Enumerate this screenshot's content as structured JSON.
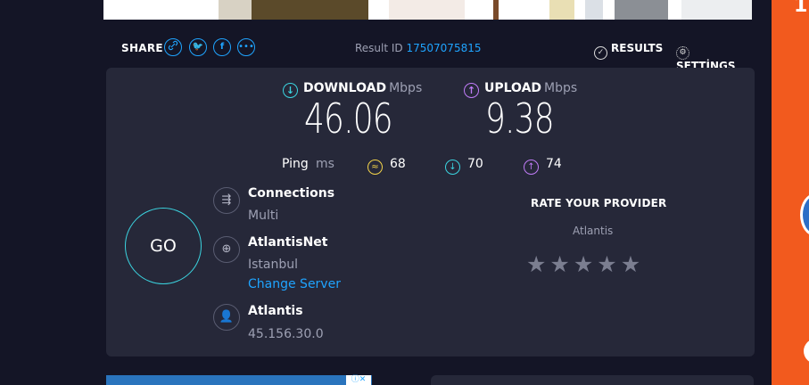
{
  "share": {
    "label": "SHARE",
    "icons": [
      "link-icon",
      "twitter-icon",
      "facebook-icon",
      "more-icon"
    ]
  },
  "result": {
    "label": "Result ID",
    "id": "17507075815"
  },
  "nav": {
    "results": "RESULTS",
    "settings": "SETTİNGS"
  },
  "download": {
    "label": "DOWNLOAD",
    "unit": "Mbps",
    "value": "46.06"
  },
  "upload": {
    "label": "UPLOAD",
    "unit": "Mbps",
    "value": "9.38"
  },
  "ping": {
    "label": "Ping",
    "unit": "ms",
    "idle": "68",
    "down": "70",
    "up": "74"
  },
  "go": {
    "label": "GO"
  },
  "connections": {
    "title": "Connections",
    "value": "Multi"
  },
  "server": {
    "title": "AtlantisNet",
    "location": "Istanbul",
    "change": "Change Server"
  },
  "client": {
    "title": "Atlantis",
    "ip": "45.156.30.0"
  },
  "rating": {
    "title": "RATE YOUR PROVIDER",
    "provider": "Atlantis",
    "stars": 5
  },
  "colors": {
    "download": "#3bd4e0",
    "upload": "#c07cf8",
    "idle": "#f3d34a",
    "accent": "#1fa4ff",
    "rail": "#f25a1e"
  }
}
